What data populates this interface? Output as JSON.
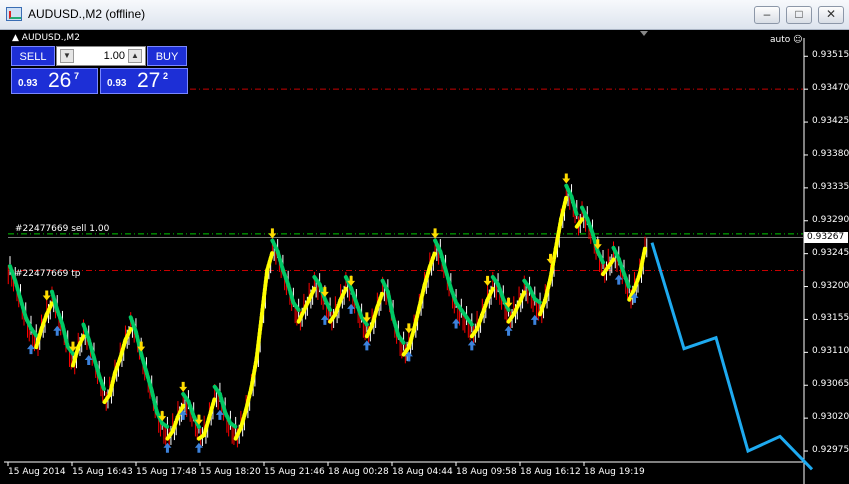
{
  "window": {
    "title": "AUDUSD.,M2 (offline)",
    "minimize": "–",
    "maximize": "□",
    "close": "✕"
  },
  "chart_header": {
    "symbol": "AUDUSD.,M2",
    "auto": "auto"
  },
  "trade_panel": {
    "sell_label": "SELL",
    "buy_label": "BUY",
    "lot": "1.00",
    "bid_prefix": "0.93",
    "bid_big": "26",
    "bid_sup": "7",
    "ask_prefix": "0.93",
    "ask_big": "27",
    "ask_sup": "2"
  },
  "order_lines": {
    "sell_label": "#22477669 sell 1.00",
    "tp_label": "#22477669 tp",
    "current_price": "0.93267"
  },
  "colors": {
    "background": "#000000",
    "bull_candle": "#ffffff",
    "bear_candle": "#ff0000",
    "trend_up": "#ffff00",
    "trend_down": "#00c864",
    "forecast": "#1eaaf0",
    "entry_line": "#00c800",
    "tp_line": "#c80000",
    "buy_arrow": "#3c82dc",
    "sell_arrow": "#ffdc00"
  },
  "chart_data": {
    "type": "candlestick",
    "y_ticks": [
      "0.93515",
      "0.93470",
      "0.93425",
      "0.93380",
      "0.93335",
      "0.93290",
      "0.93245",
      "0.93200",
      "0.93155",
      "0.93110",
      "0.93065",
      "0.93020",
      "0.92975"
    ],
    "x_ticks": [
      "15 Aug 2014",
      "15 Aug 16:43",
      "15 Aug 17:48",
      "15 Aug 18:20",
      "15 Aug 21:46",
      "18 Aug 00:28",
      "18 Aug 04:44",
      "18 Aug 09:58",
      "18 Aug 16:12",
      "18 Aug 19:19"
    ],
    "ylim": [
      0.9296,
      0.9354
    ],
    "levels": {
      "upper_tp": 0.9347,
      "entry": 0.93272,
      "current": 0.93267,
      "tp": 0.93222
    },
    "close_path": [
      0.9322,
      0.932,
      0.93175,
      0.9315,
      0.93135,
      0.93125,
      0.9315,
      0.9317,
      0.93185,
      0.9316,
      0.9314,
      0.9311,
      0.931,
      0.93125,
      0.9314,
      0.9312,
      0.93095,
      0.9307,
      0.9305,
      0.9306,
      0.9309,
      0.9311,
      0.93135,
      0.9315,
      0.9313,
      0.931,
      0.93075,
      0.9305,
      0.9302,
      0.93005,
      0.93,
      0.9301,
      0.9303,
      0.93045,
      0.93035,
      0.93015,
      0.93,
      0.93005,
      0.9303,
      0.93055,
      0.93045,
      0.9302,
      0.93005,
      0.93,
      0.93015,
      0.9304,
      0.9307,
      0.9311,
      0.9317,
      0.9323,
      0.93255,
      0.9324,
      0.93215,
      0.93195,
      0.9317,
      0.9316,
      0.93175,
      0.9319,
      0.93205,
      0.93195,
      0.93175,
      0.9316,
      0.9317,
      0.9319,
      0.93205,
      0.9319,
      0.9317,
      0.9315,
      0.9314,
      0.93155,
      0.9318,
      0.932,
      0.93185,
      0.9315,
      0.93125,
      0.93115,
      0.93125,
      0.9315,
      0.9318,
      0.9321,
      0.93235,
      0.93255,
      0.9324,
      0.93215,
      0.9319,
      0.9317,
      0.9316,
      0.9315,
      0.9314,
      0.9315,
      0.9317,
      0.9319,
      0.93205,
      0.93195,
      0.93175,
      0.9316,
      0.9317,
      0.93185,
      0.932,
      0.9319,
      0.93175,
      0.9317,
      0.9319,
      0.9322,
      0.9326,
      0.933,
      0.9333,
      0.93315,
      0.9329,
      0.933,
      0.93285,
      0.93265,
      0.9324,
      0.93225,
      0.93235,
      0.93245,
      0.9323,
      0.9321,
      0.9319,
      0.93205,
      0.93225,
      0.9326
    ],
    "forecast_line": [
      [
        0.9326
      ],
      [
        0.93115
      ],
      [
        0.9313
      ],
      [
        0.92975
      ],
      [
        0.92995
      ],
      [
        0.9295
      ]
    ],
    "buy_arrow_positions": [
      4,
      9,
      15,
      30,
      33,
      36,
      40,
      60,
      65,
      68,
      76,
      85,
      88,
      95,
      100,
      116,
      119
    ],
    "sell_arrow_positions": [
      7,
      12,
      25,
      29,
      33,
      36,
      50,
      60,
      65,
      68,
      76,
      81,
      91,
      95,
      103,
      106,
      112
    ]
  }
}
